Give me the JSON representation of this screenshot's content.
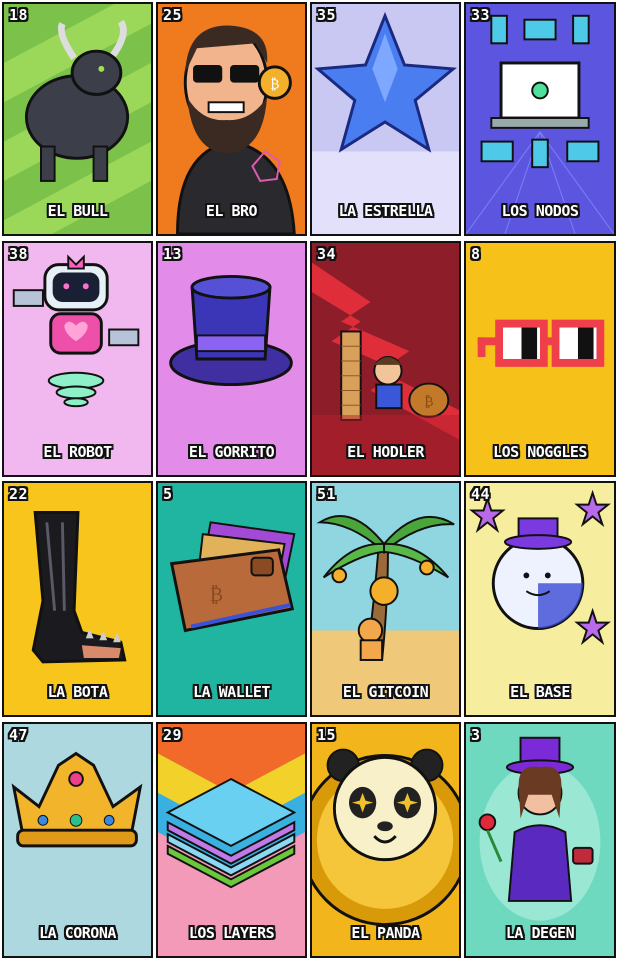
{
  "cards": [
    {
      "number": "18",
      "name": "EL BULL",
      "icon": "bull-icon",
      "bg": "#7cc24a"
    },
    {
      "number": "25",
      "name": "EL BRO",
      "icon": "bro-icon",
      "bg": "#f07a1e"
    },
    {
      "number": "35",
      "name": "LA ESTRELLA",
      "icon": "star-icon",
      "bg": "#c9c8f2"
    },
    {
      "number": "33",
      "name": "LOS NODOS",
      "icon": "nodes-icon",
      "bg": "#5b55e0"
    },
    {
      "number": "38",
      "name": "EL ROBOT",
      "icon": "robot-icon",
      "bg": "#f1b8f0"
    },
    {
      "number": "13",
      "name": "EL GORRITO",
      "icon": "top-hat-icon",
      "bg": "#e28be8"
    },
    {
      "number": "34",
      "name": "EL HODLER",
      "icon": "hodler-icon",
      "bg": "#8e1d2a"
    },
    {
      "number": "8",
      "name": "LOS NOGGLES",
      "icon": "noggles-icon",
      "bg": "#f6c21a"
    },
    {
      "number": "22",
      "name": "LA BOTA",
      "icon": "boot-icon",
      "bg": "#f7c51c"
    },
    {
      "number": "5",
      "name": "LA WALLET",
      "icon": "wallet-icon",
      "bg": "#1fb5a0"
    },
    {
      "number": "51",
      "name": "EL GITCOIN",
      "icon": "gitcoin-icon",
      "bg": "#8fd6e0"
    },
    {
      "number": "44",
      "name": "EL BASE",
      "icon": "base-icon",
      "bg": "#f6ee9e"
    },
    {
      "number": "47",
      "name": "LA CORONA",
      "icon": "crown-icon",
      "bg": "#a7e3d4"
    },
    {
      "number": "29",
      "name": "LOS LAYERS",
      "icon": "layers-icon",
      "bg": "#4ab48a"
    },
    {
      "number": "15",
      "name": "EL PANDA",
      "icon": "panda-icon",
      "bg": "#f2b61c"
    },
    {
      "number": "3",
      "name": "LA DEGEN",
      "icon": "degen-icon",
      "bg": "#6fd9c0"
    }
  ]
}
